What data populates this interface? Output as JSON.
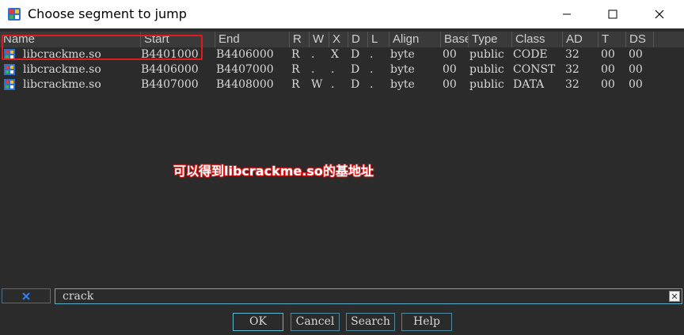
{
  "window": {
    "title": "Choose segment to jump",
    "icons": {
      "app": "ida-app-icon",
      "minimize": "minimize-icon",
      "maximize": "maximize-icon",
      "close": "close-icon"
    }
  },
  "table": {
    "columns": [
      "Name",
      "Start",
      "End",
      "R",
      "W",
      "X",
      "D",
      "L",
      "Align",
      "Base",
      "Type",
      "Class",
      "AD",
      "T",
      "DS"
    ],
    "rows": [
      {
        "name": "libcrackme.so",
        "start": "B4401000",
        "end": "B4406000",
        "r": "R",
        "w": ".",
        "x": "X",
        "d": "D",
        "l": ".",
        "align": "byte",
        "base": "00",
        "type": "public",
        "class": "CODE",
        "ad": "32",
        "t": "00",
        "ds": "00"
      },
      {
        "name": "libcrackme.so",
        "start": "B4406000",
        "end": "B4407000",
        "r": "R",
        "w": ".",
        "x": ".",
        "d": "D",
        "l": ".",
        "align": "byte",
        "base": "00",
        "type": "public",
        "class": "CONST",
        "ad": "32",
        "t": "00",
        "ds": "00"
      },
      {
        "name": "libcrackme.so",
        "start": "B4407000",
        "end": "B4408000",
        "r": "R",
        "w": "W",
        "x": ".",
        "d": "D",
        "l": ".",
        "align": "byte",
        "base": "00",
        "type": "public",
        "class": "DATA",
        "ad": "32",
        "t": "00",
        "ds": "00"
      }
    ]
  },
  "annotation": {
    "text": "可以得到libcrackme.so的基地址",
    "color": "#e01b1b"
  },
  "filter": {
    "value": "crack",
    "clear_icon": "clear-filter-icon"
  },
  "buttons": {
    "ok": "OK",
    "cancel": "Cancel",
    "search": "Search",
    "help": "Help"
  }
}
